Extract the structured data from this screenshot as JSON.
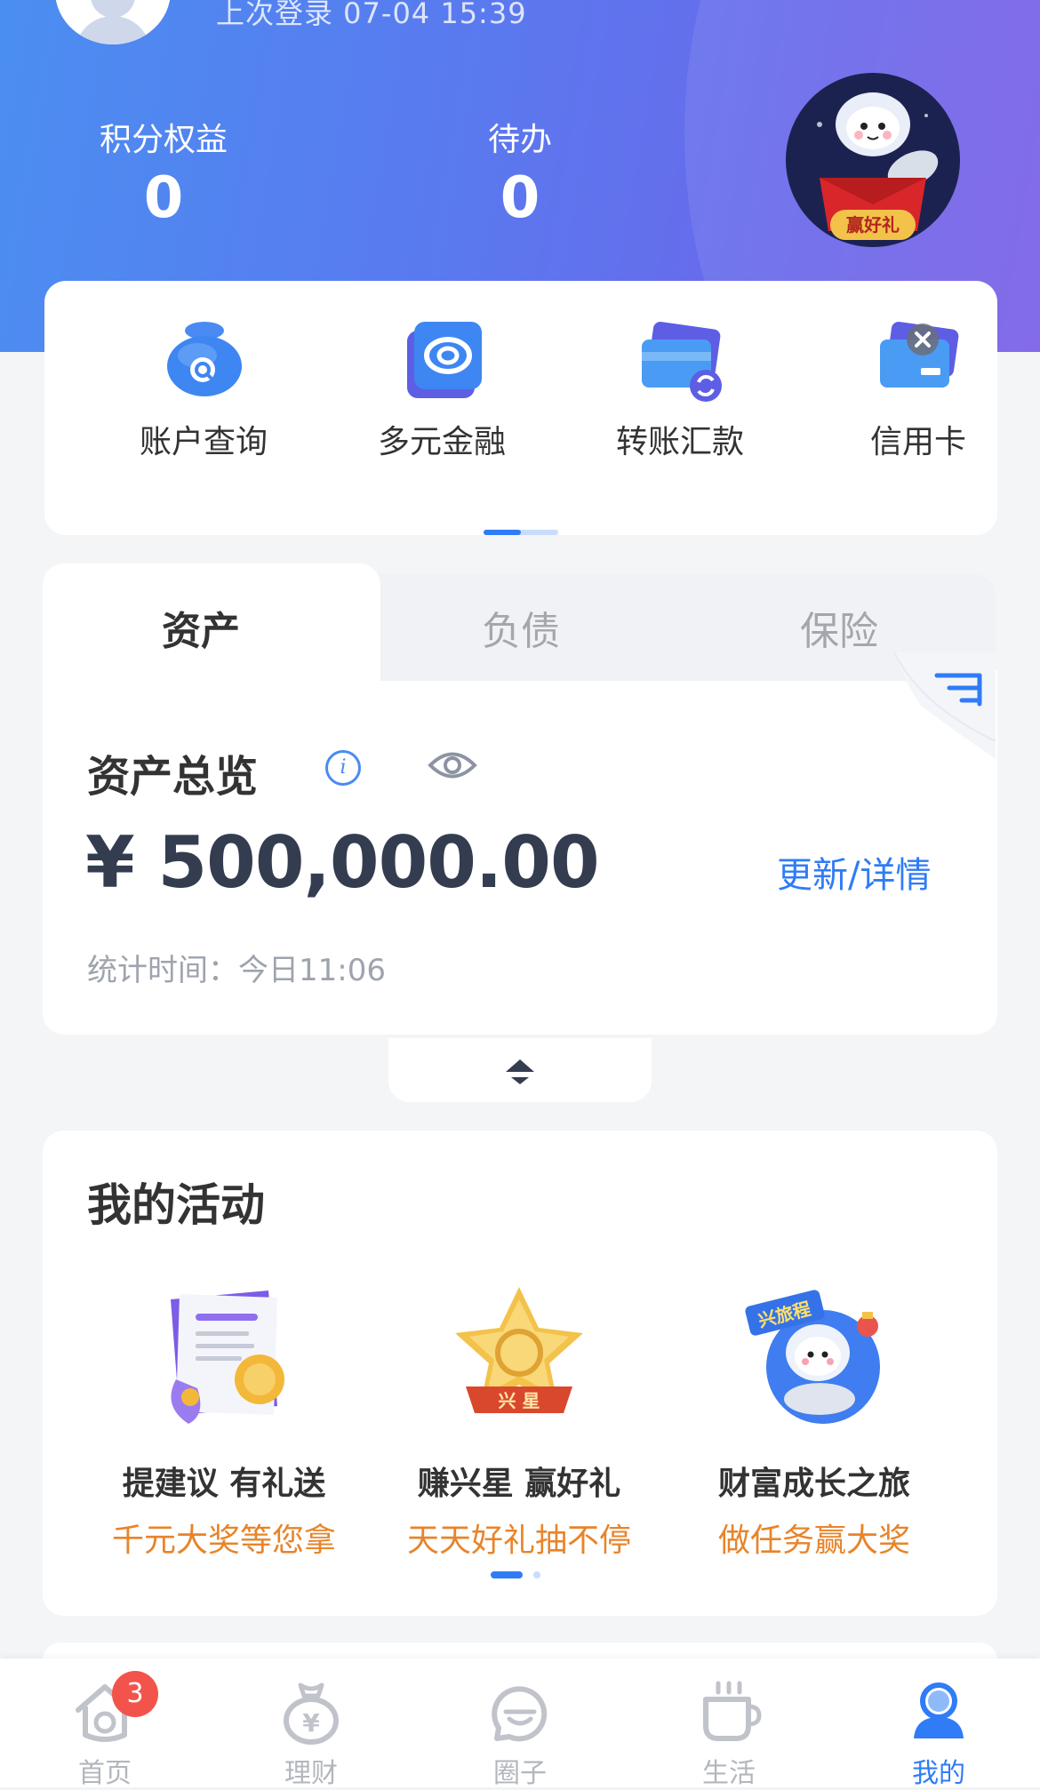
{
  "header": {
    "last_login": "上次登录 07-04 15:39",
    "stats": [
      {
        "label": "积分权益",
        "value": "0"
      },
      {
        "label": "待办",
        "value": "0"
      }
    ],
    "mascot_badge": "赢好礼"
  },
  "quick_actions": [
    {
      "label": "账户查询",
      "icon": "money-bag-search-icon"
    },
    {
      "label": "多元金融",
      "icon": "diversified-finance-icon"
    },
    {
      "label": "转账汇款",
      "icon": "card-transfer-icon"
    },
    {
      "label": "信用卡",
      "icon": "credit-card-icon"
    }
  ],
  "asset_tabs": {
    "items": [
      "资产",
      "负债",
      "保险"
    ],
    "active": "资产"
  },
  "asset_overview": {
    "title": "资产总览",
    "amount": "¥ 500,000.00",
    "update_link": "更新/详情",
    "stat_time": "统计时间：今日11:06"
  },
  "activities": {
    "title": "我的活动",
    "items": [
      {
        "name": "提建议 有礼送",
        "desc": "千元大奖等您拿",
        "icon": "suggestion-document-icon"
      },
      {
        "name": "赚兴星 赢好礼",
        "desc": "天天好礼抽不停",
        "icon": "star-badge-icon",
        "badge_text": "兴 星"
      },
      {
        "name": "财富成长之旅",
        "desc": "做任务赢大奖",
        "icon": "astronaut-rocket-icon",
        "badge_text": "兴旅程"
      }
    ]
  },
  "bottom_nav": {
    "items": [
      {
        "label": "首页",
        "icon": "home-icon",
        "badge": "3",
        "active": false
      },
      {
        "label": "理财",
        "icon": "money-bag-icon",
        "active": false
      },
      {
        "label": "圈子",
        "icon": "chat-face-icon",
        "active": false
      },
      {
        "label": "生活",
        "icon": "coffee-cup-icon",
        "active": false
      },
      {
        "label": "我的",
        "icon": "user-icon",
        "active": true
      }
    ]
  },
  "colors": {
    "primary": "#2f7cf6",
    "accent_orange": "#e8842a",
    "header_start": "#4b8ef1",
    "header_end": "#7a5fe6",
    "badge_red": "#f2544c"
  }
}
